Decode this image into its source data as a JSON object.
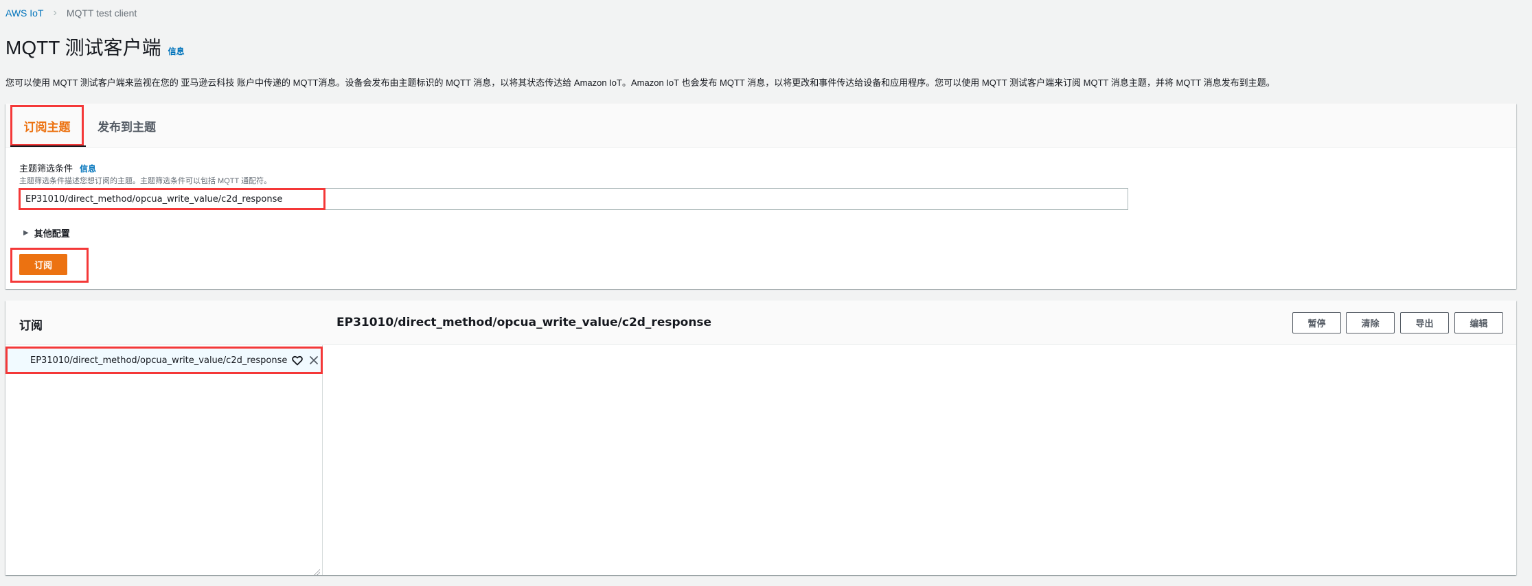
{
  "breadcrumb": {
    "items": [
      {
        "label": "AWS IoT",
        "link": true
      },
      {
        "label": "MQTT test client",
        "link": false
      }
    ],
    "separator_icon": "chevron-right-icon"
  },
  "header": {
    "title": "MQTT 测试客户端",
    "info_label": "信息"
  },
  "description": "您可以使用 MQTT 测试客户端来监视在您的 亚马逊云科技 账户中传递的 MQTT消息。设备会发布由主题标识的 MQTT 消息，以将其状态传达给 Amazon IoT。Amazon IoT 也会发布 MQTT 消息，以将更改和事件传达给设备和应用程序。您可以使用 MQTT 测试客户端来订阅 MQTT 消息主题，并将 MQTT 消息发布到主题。",
  "tabs": [
    {
      "label": "订阅主题",
      "active": true
    },
    {
      "label": "发布到主题",
      "active": false
    }
  ],
  "subscribe_form": {
    "filter_label": "主题筛选条件",
    "filter_info": "信息",
    "filter_hint": "主题筛选条件描述您想订阅的主题。主题筛选条件可以包括 MQTT 通配符。",
    "filter_value": "EP31010/direct_method/opcua_write_value/c2d_response",
    "other_config_label": "其他配置",
    "subscribe_button": "订阅"
  },
  "subscriptions": {
    "heading": "订阅",
    "items": [
      {
        "topic": "EP31010/direct_method/opcua_write_value/c2d_response",
        "favorite_icon": "heart-icon",
        "remove_icon": "close-icon"
      }
    ],
    "selected_topic": "EP31010/direct_method/opcua_write_value/c2d_response",
    "actions": {
      "pause": "暂停",
      "clear": "清除",
      "export": "导出",
      "edit": "编辑"
    }
  },
  "colors": {
    "accent": "#ec7211",
    "link": "#0073bb",
    "highlight_box": "#f43838",
    "selected_row_bg": "#f1faff"
  }
}
